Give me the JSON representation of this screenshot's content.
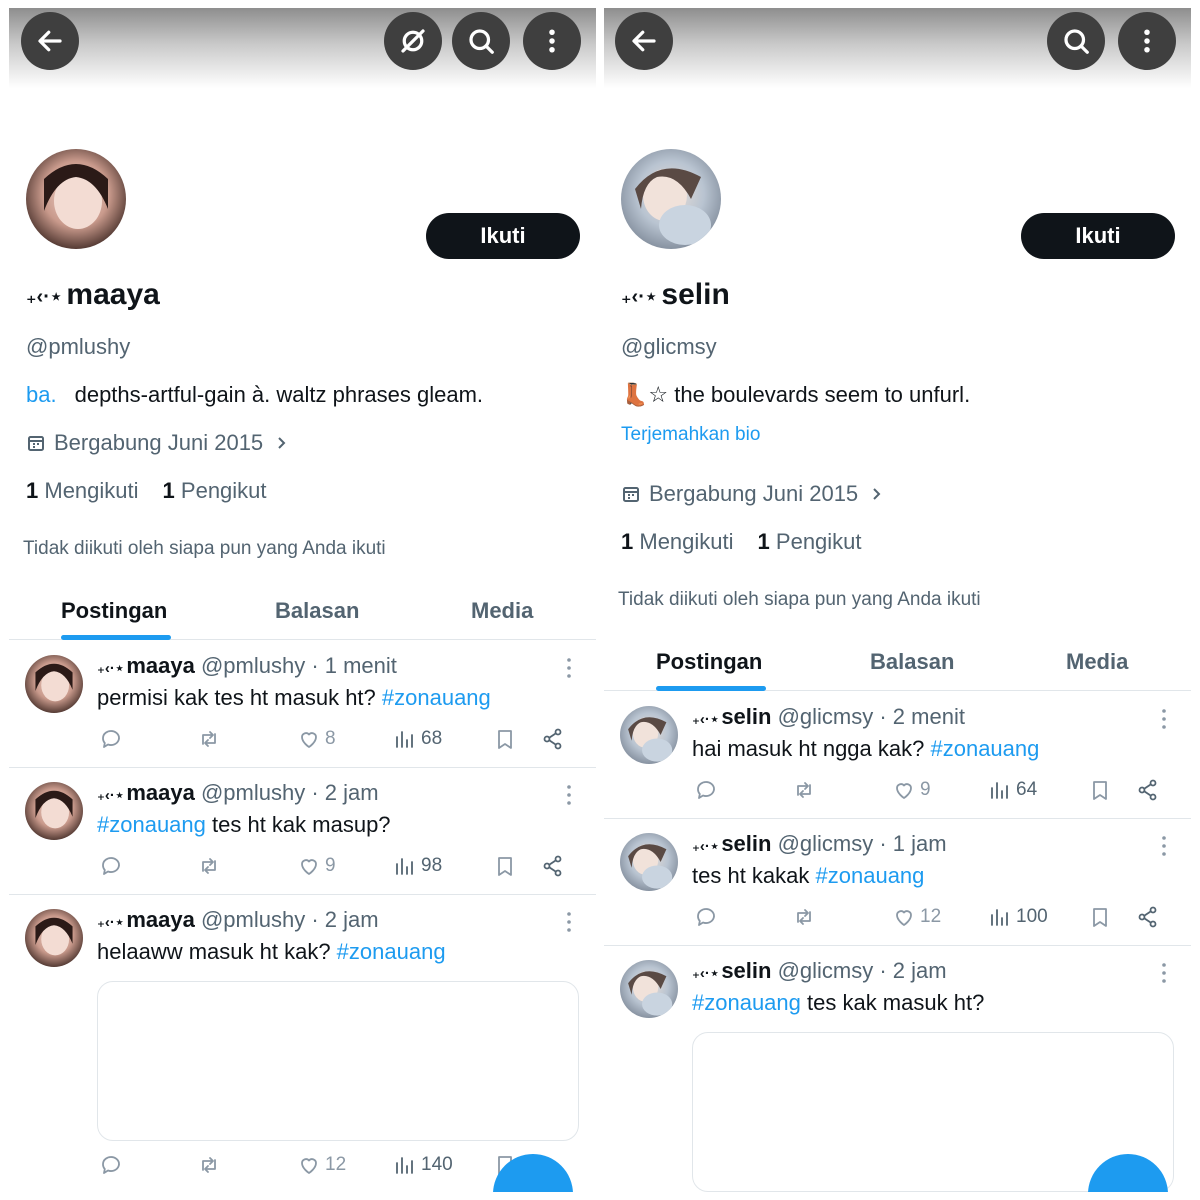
{
  "colors": {
    "accent": "#1d9bf0",
    "text": "#0f1419",
    "muted": "#536471",
    "button": "#0f1419"
  },
  "left": {
    "topbar": {
      "icons": [
        "back-arrow-icon",
        "grok-icon",
        "search-icon",
        "more-vertical-icon"
      ]
    },
    "follow_label": "Ikuti",
    "decoration": "₊‹·⋆",
    "name": "maaya",
    "handle": "@pmlushy",
    "bio_link": "ba.",
    "bio": "depths-artful-gain à. waltz phrases gleam.",
    "joined": "Bergabung Juni 2015",
    "following_count": "1",
    "following_label": "Mengikuti",
    "followers_count": "1",
    "followers_label": "Pengikut",
    "not_followed": "Tidak diikuti oleh siapa pun yang Anda ikuti",
    "tabs": [
      "Postingan",
      "Balasan",
      "Media"
    ],
    "posts": [
      {
        "name": "maaya",
        "meta": "@pmlushy · 1 menit",
        "text": "permisi kak tes ht masuk ht? ",
        "tag": "#zonauang",
        "likes": "8",
        "views": "68"
      },
      {
        "name": "maaya",
        "meta": "@pmlushy · 2 jam",
        "text_after": " tes ht kak masup?",
        "tag": "#zonauang",
        "likes": "9",
        "views": "98"
      },
      {
        "name": "maaya",
        "meta": "@pmlushy · 2 jam",
        "text": "helaaww masuk ht kak? ",
        "tag": "#zonauang",
        "likes": "12",
        "views": "140"
      }
    ]
  },
  "right": {
    "topbar": {
      "icons": [
        "back-arrow-icon",
        "search-icon",
        "more-vertical-icon"
      ]
    },
    "follow_label": "Ikuti",
    "decoration": "₊‹·⋆",
    "name": "selin",
    "handle": "@glicmsy",
    "bio": "👢☆ the boulevards seem to unfurl.",
    "translate": "Terjemahkan bio",
    "joined": "Bergabung Juni 2015",
    "following_count": "1",
    "following_label": "Mengikuti",
    "followers_count": "1",
    "followers_label": "Pengikut",
    "not_followed": "Tidak diikuti oleh siapa pun yang Anda ikuti",
    "tabs": [
      "Postingan",
      "Balasan",
      "Media"
    ],
    "posts": [
      {
        "name": "selin",
        "meta": "@glicmsy · 2 menit",
        "text": "hai masuk ht ngga kak? ",
        "tag": "#zonauang",
        "likes": "9",
        "views": "64"
      },
      {
        "name": "selin",
        "meta": "@glicmsy · 1 jam",
        "text": "tes ht kakak ",
        "tag": "#zonauang",
        "likes": "12",
        "views": "100"
      },
      {
        "name": "selin",
        "meta": "@glicmsy · 2 jam",
        "text_after": " tes kak masuk ht?",
        "tag": "#zonauang"
      }
    ]
  }
}
